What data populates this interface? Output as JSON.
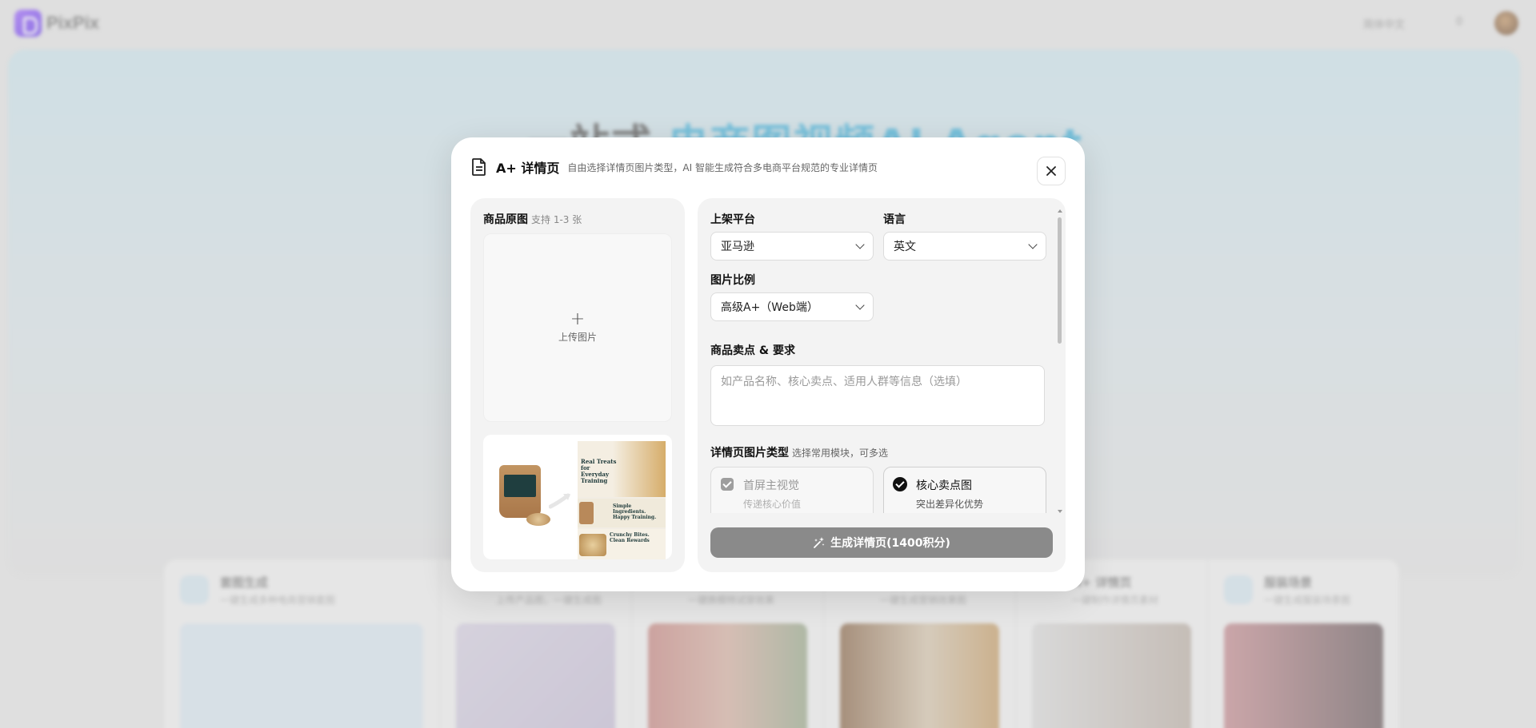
{
  "background": {
    "brand": "PixPix",
    "language_selector": "简体中文",
    "credits": "0",
    "hero_title_plain": "一站式",
    "hero_title_accent": "电商图视频AI Agent",
    "cards": [
      {
        "title": "套图生成",
        "subtitle": "一键生成多种电商营销套图"
      },
      {
        "title": "",
        "subtitle": "上传产品图，一键生成图"
      },
      {
        "title": "",
        "subtitle": "一键换模特试穿效果"
      },
      {
        "title": "",
        "subtitle": "一键生成营销效果图"
      },
      {
        "title": "A+ 详情页",
        "subtitle": "一键制作详情页素材"
      },
      {
        "title": "服装场景",
        "subtitle": "一键生成服装场景图"
      }
    ]
  },
  "modal": {
    "title": "A+ 详情页",
    "subtitle": "自由选择详情页图片类型，AI 智能生成符合多电商平台规范的专业详情页",
    "left": {
      "label": "商品原图",
      "hint": "支持 1-3 张",
      "upload_label": "上传图片",
      "example": {
        "panel1": "Real Treats for Everyday Training",
        "panel2": "Simple Ingredients. Happy Training.",
        "panel3": "Crunchy Bites. Clean Rewards"
      }
    },
    "right": {
      "platform_label": "上架平台",
      "platform_value": "亚马逊",
      "language_label": "语言",
      "language_value": "英文",
      "ratio_label": "图片比例",
      "ratio_value": "高级A+（Web端）",
      "selling_label": "商品卖点 & 要求",
      "selling_placeholder": "如产品名称、核心卖点、适用人群等信息（选填）",
      "types_label": "详情页图片类型",
      "types_hint": "选择常用模块，可多选",
      "types": [
        {
          "title": "首屏主视觉",
          "subtitle": "传递核心价值",
          "checked": true,
          "locked": true
        },
        {
          "title": "核心卖点图",
          "subtitle": "突出差异化优势",
          "checked": true,
          "locked": false
        }
      ],
      "generate_label": "生成详情页(1400积分)"
    }
  }
}
